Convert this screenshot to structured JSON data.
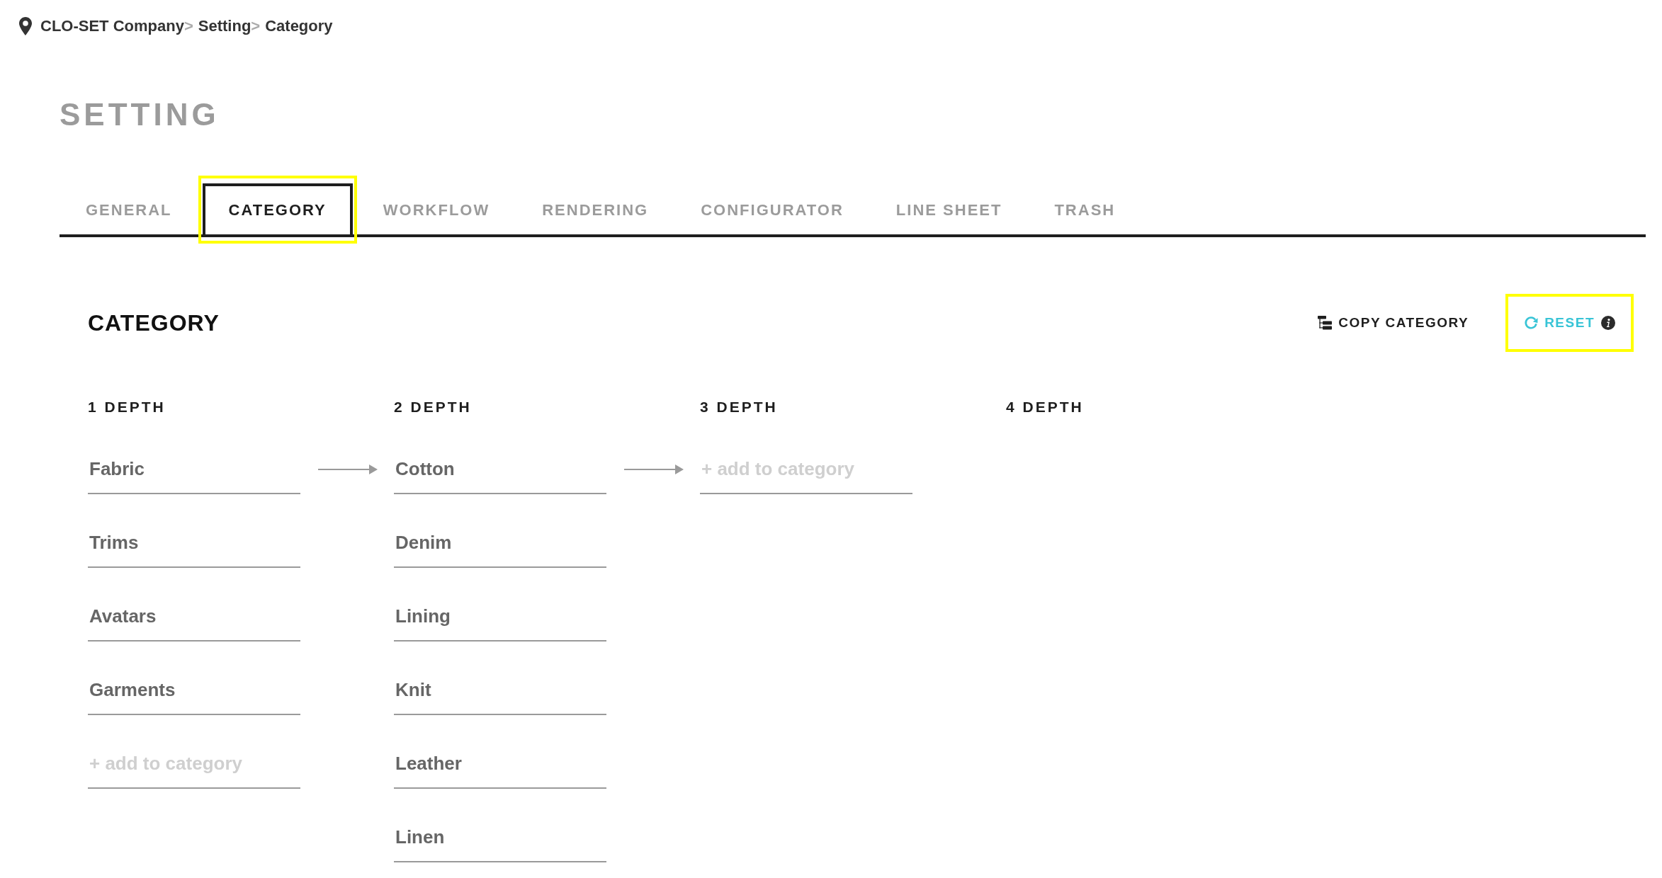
{
  "breadcrumb": [
    {
      "label": "CLO-SET Company",
      "separator": ">"
    },
    {
      "label": "Setting",
      "separator": ">"
    },
    {
      "label": "Category"
    }
  ],
  "page_title": "SETTING",
  "tabs": [
    {
      "label": "GENERAL",
      "selected": false,
      "highlighted": false
    },
    {
      "label": "CATEGORY",
      "selected": true,
      "highlighted": true
    },
    {
      "label": "WORKFLOW",
      "selected": false,
      "highlighted": false
    },
    {
      "label": "RENDERING",
      "selected": false,
      "highlighted": false
    },
    {
      "label": "CONFIGURATOR",
      "selected": false,
      "highlighted": false
    },
    {
      "label": "LINE SHEET",
      "selected": false,
      "highlighted": false
    },
    {
      "label": "TRASH",
      "selected": false,
      "highlighted": false
    }
  ],
  "section": {
    "title": "CATEGORY",
    "actions": [
      {
        "kind": "copy",
        "label": "COPY CATEGORY",
        "highlighted": false
      },
      {
        "kind": "reset",
        "label": "RESET",
        "highlighted": true
      }
    ]
  },
  "depth_columns": [
    {
      "header": "1 DEPTH",
      "items": [
        {
          "value": "Fabric",
          "selected": true
        },
        {
          "value": "Trims",
          "selected": false
        },
        {
          "value": "Avatars",
          "selected": false
        },
        {
          "value": "Garments",
          "selected": false
        }
      ],
      "new_item": {
        "placeholder": "+ add to category"
      }
    },
    {
      "header": "2 DEPTH",
      "items": [
        {
          "value": "Cotton",
          "selected": true
        },
        {
          "value": "Denim",
          "selected": false
        },
        {
          "value": "Lining",
          "selected": false
        },
        {
          "value": "Knit",
          "selected": false
        },
        {
          "value": "Leather",
          "selected": false
        },
        {
          "value": "Linen",
          "selected": false
        }
      ]
    },
    {
      "header": "3 DEPTH",
      "new_item": {
        "placeholder": "+ add to category"
      }
    },
    {
      "header": "4 DEPTH"
    }
  ]
}
